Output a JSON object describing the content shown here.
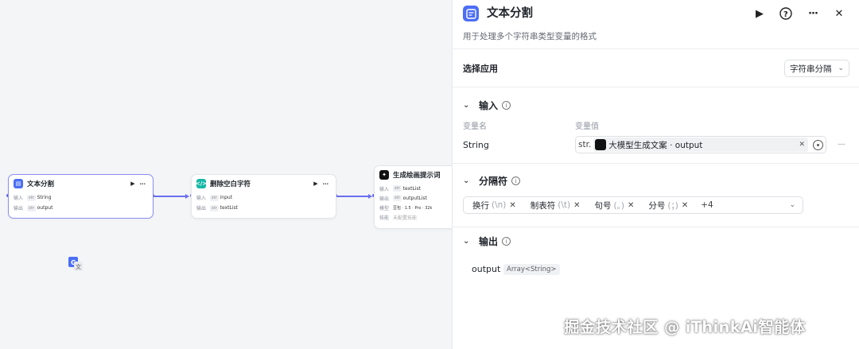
{
  "canvas": {
    "nodes": [
      {
        "title": "文本分割",
        "rows": [
          {
            "key": "输入",
            "type": "str",
            "value": "String"
          },
          {
            "key": "输出",
            "type": "str",
            "value": "output"
          }
        ]
      },
      {
        "title": "删除空白字符",
        "rows": [
          {
            "key": "输入",
            "type": "str",
            "value": "input"
          },
          {
            "key": "输出",
            "type": "str",
            "value": "textList"
          }
        ]
      },
      {
        "title": "生成绘画提示词",
        "rows": [
          {
            "key": "输入",
            "type": "str",
            "value": "textList"
          },
          {
            "key": "输出",
            "type": "str",
            "value": "outputList"
          },
          {
            "key": "模型",
            "type": "",
            "value": "豆包 · 1.5 · Pro · 32k"
          },
          {
            "key": "技能",
            "type": "",
            "value": "未配置技能"
          }
        ]
      }
    ]
  },
  "panel": {
    "title": "文本分割",
    "description": "用于处理多个字符串类型变量的格式",
    "select_app_label": "选择应用",
    "select_app_value": "字符串分隔",
    "input_section": "输入",
    "col_name": "变量名",
    "col_value": "变量值",
    "var_name": "String",
    "var_type_tag": "str.",
    "var_ref": "大模型生成文案 · output",
    "separator_section": "分隔符",
    "separators": [
      {
        "label": "换行",
        "sub": "(\\n)"
      },
      {
        "label": "制表符",
        "sub": "(\\t)"
      },
      {
        "label": "句号",
        "sub": "(。)"
      },
      {
        "label": "分号",
        "sub": "(；)"
      }
    ],
    "more_count": "+4",
    "output_section": "输出",
    "output_name": "output",
    "output_type": "Array<String>"
  },
  "watermark": "掘金技术社区 @ iThinkAi智能体",
  "colors": {
    "accent": "#6366f1",
    "app_icon": "#4c6ef5",
    "code_icon": "#14b8a6"
  }
}
